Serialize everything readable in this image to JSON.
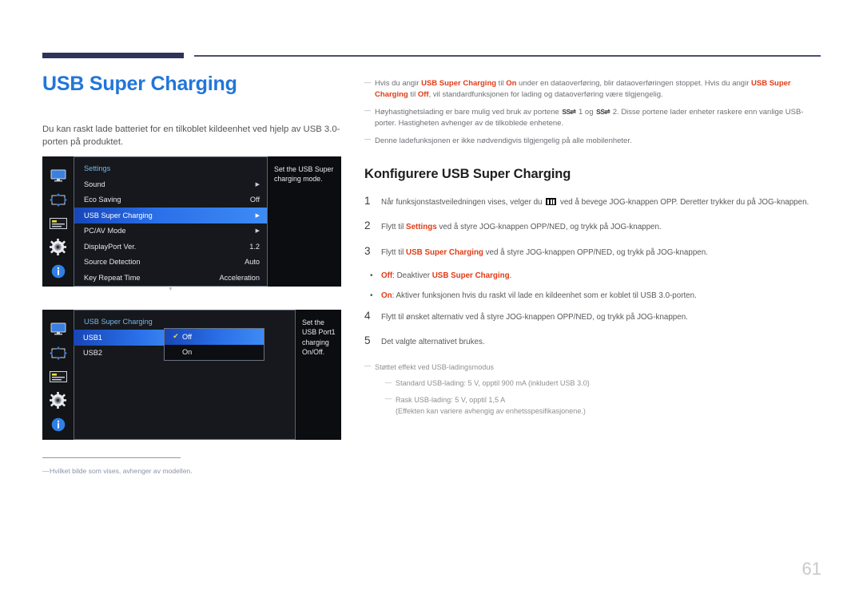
{
  "page": {
    "title": "USB Super Charging",
    "intro": "Du kan raskt lade batteriet for en tilkoblet kildeenhet ved hjelp av USB 3.0-porten på produktet.",
    "number": "61"
  },
  "colors": {
    "title_blue": "#2176d9",
    "accent_red": "#e23b16",
    "rule_navy": "#2e3359",
    "osd_highlight_blue": "#2a6fe8",
    "footnote_blue_gray": "#8c92ab"
  },
  "osd_menu_1": {
    "rail_icons": [
      "monitor-icon",
      "picture-size-icon",
      "osd-list-icon",
      "gear-icon",
      "info-icon"
    ],
    "header": "Settings",
    "rows": [
      {
        "label": "Sound",
        "value": "",
        "arrow": "▶",
        "selected": false
      },
      {
        "label": "Eco Saving",
        "value": "Off",
        "arrow": "",
        "selected": false
      },
      {
        "label": "USB Super Charging",
        "value": "",
        "arrow": "▶",
        "selected": true
      },
      {
        "label": "PC/AV Mode",
        "value": "",
        "arrow": "▶",
        "selected": false
      },
      {
        "label": "DisplayPort Ver.",
        "value": "1.2",
        "arrow": "",
        "selected": false
      },
      {
        "label": "Source Detection",
        "value": "Auto",
        "arrow": "",
        "selected": false
      },
      {
        "label": "Key Repeat Time",
        "value": "Acceleration",
        "arrow": "",
        "selected": false
      }
    ],
    "scroll_down": "▼",
    "description": "Set the USB Super charging mode."
  },
  "osd_menu_2": {
    "rail_icons": [
      "monitor-icon",
      "picture-size-icon",
      "osd-list-icon",
      "gear-icon",
      "info-icon"
    ],
    "header": "USB Super Charging",
    "ports": [
      {
        "label": "USB1",
        "selected": true
      },
      {
        "label": "USB2",
        "selected": false
      }
    ],
    "popup": [
      {
        "label": "Off",
        "checked": true,
        "selected": true
      },
      {
        "label": "On",
        "checked": false,
        "selected": false
      }
    ],
    "check_glyph": "✔",
    "description": "Set the USB Port1 charging On/Off."
  },
  "left_footnote": {
    "dash": "—",
    "text": "Hvilket bilde som vises, avhenger av modellen."
  },
  "notes": [
    {
      "parts": [
        {
          "t": "Hvis du angir ",
          "b": false
        },
        {
          "t": "USB Super Charging",
          "b": true
        },
        {
          "t": " til ",
          "b": false
        },
        {
          "t": "On",
          "b": true
        },
        {
          "t": " under en dataoverføring, blir dataoverføringen stoppet. Hvis du angir ",
          "b": false
        },
        {
          "t": "USB Super Charging",
          "b": true
        },
        {
          "t": " til ",
          "b": false
        },
        {
          "t": "Off",
          "b": true
        },
        {
          "t": ", vil standardfunksjonen for lading og dataoverføring være tilgjengelig.",
          "b": false
        }
      ]
    },
    {
      "parts": [
        {
          "t": "Høyhastighetslading er bare mulig ved bruk av portene ",
          "b": false
        },
        {
          "t": "SS⇌",
          "b": false,
          "glyph": true
        },
        {
          "t": " 1 og ",
          "b": false
        },
        {
          "t": "SS⇌",
          "b": false,
          "glyph": true
        },
        {
          "t": " 2. Disse portene lader enheter raskere enn vanlige USB-porter. Hastigheten avhenger av de tilkoblede enhetene.",
          "b": false
        }
      ]
    },
    {
      "parts": [
        {
          "t": "Denne ladefunksjonen er ikke nødvendigvis tilgjengelig på alle mobilenheter.",
          "b": false
        }
      ]
    }
  ],
  "section": {
    "title": "Konfigurere USB Super Charging",
    "steps": [
      {
        "num": "1",
        "parts": [
          {
            "t": "Når funksjonstastveiledningen vises, velger du ",
            "b": false
          },
          {
            "t": "menu-icon",
            "menuGlyph": true
          },
          {
            "t": " ved å bevege JOG-knappen OPP. Deretter trykker du på JOG-knappen.",
            "b": false
          }
        ]
      },
      {
        "num": "2",
        "parts": [
          {
            "t": "Flytt til ",
            "b": false
          },
          {
            "t": "Settings",
            "b": true
          },
          {
            "t": " ved å styre JOG-knappen OPP/NED, og trykk på JOG-knappen.",
            "b": false
          }
        ]
      },
      {
        "num": "3",
        "parts": [
          {
            "t": "Flytt til ",
            "b": false
          },
          {
            "t": "USB Super Charging",
            "b": true
          },
          {
            "t": " ved å styre JOG-knappen OPP/NED, og trykk på JOG-knappen.",
            "b": false
          }
        ]
      }
    ],
    "bullets": [
      {
        "dot": "•",
        "parts": [
          {
            "t": "Off",
            "b": true
          },
          {
            "t": ": Deaktiver ",
            "b": false
          },
          {
            "t": "USB Super Charging",
            "b": true
          },
          {
            "t": ".",
            "b": false
          }
        ]
      },
      {
        "dot": "•",
        "parts": [
          {
            "t": "On",
            "b": true
          },
          {
            "t": ": Aktiver funksjonen hvis du raskt vil lade en kildeenhet som er koblet til USB 3.0-porten.",
            "b": false
          }
        ]
      }
    ],
    "steps_after": [
      {
        "num": "4",
        "parts": [
          {
            "t": "Flytt til ønsket alternativ ved å styre JOG-knappen OPP/NED, og trykk på JOG-knappen.",
            "b": false
          }
        ]
      },
      {
        "num": "5",
        "parts": [
          {
            "t": "Det valgte alternativet brukes.",
            "b": false
          }
        ]
      }
    ],
    "sub_notes": [
      {
        "level": 1,
        "text": "Støttet effekt ved USB-ladingsmodus"
      },
      {
        "level": 2,
        "text": "Standard USB-lading: 5 V, opptil 900 mA (inkludert USB 3.0)"
      },
      {
        "level": 2,
        "text": "Rask USB-lading: 5 V, opptil 1,5 A\n(Effekten kan variere avhengig av enhetsspesifikasjonene.)"
      }
    ]
  }
}
